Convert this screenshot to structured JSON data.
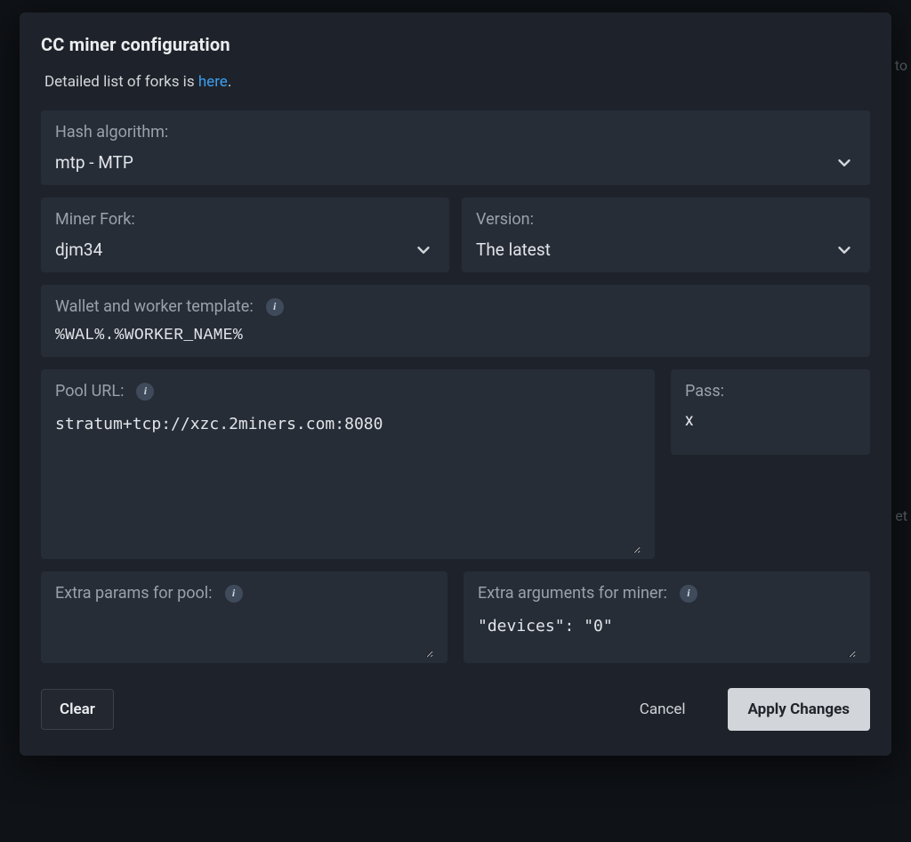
{
  "modal": {
    "title": "CC miner configuration",
    "forks_note_prefix": "Detailed list of forks is ",
    "forks_link_text": "here",
    "forks_note_suffix": "."
  },
  "hash_algorithm": {
    "label": "Hash algorithm:",
    "value": "mtp - MTP"
  },
  "miner_fork": {
    "label": "Miner Fork:",
    "value": "djm34"
  },
  "version": {
    "label": "Version:",
    "value": "The latest"
  },
  "wallet_template": {
    "label": "Wallet and worker template:",
    "value": "%WAL%.%WORKER_NAME%"
  },
  "pool_url": {
    "label": "Pool URL:",
    "value": "stratum+tcp://xzc.2miners.com:8080"
  },
  "pass": {
    "label": "Pass:",
    "value": "x"
  },
  "extra_pool": {
    "label": "Extra params for pool:",
    "value": ""
  },
  "extra_miner": {
    "label": "Extra arguments for miner:",
    "value": "\"devices\": \"0\""
  },
  "footer": {
    "clear": "Clear",
    "cancel": "Cancel",
    "apply": "Apply Changes"
  },
  "icons": {
    "info_glyph": "i"
  }
}
